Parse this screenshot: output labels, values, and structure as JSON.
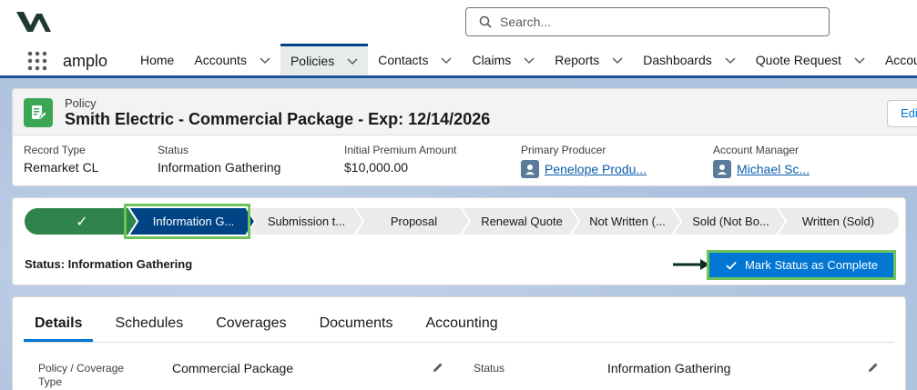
{
  "header": {
    "search_placeholder": "Search..."
  },
  "nav": {
    "app_name": "amplo",
    "items": [
      {
        "label": "Home",
        "chevron": false,
        "active": false
      },
      {
        "label": "Accounts",
        "chevron": true,
        "active": false
      },
      {
        "label": "Policies",
        "chevron": true,
        "active": true
      },
      {
        "label": "Contacts",
        "chevron": true,
        "active": false
      },
      {
        "label": "Claims",
        "chevron": true,
        "active": false
      },
      {
        "label": "Reports",
        "chevron": true,
        "active": false
      },
      {
        "label": "Dashboards",
        "chevron": true,
        "active": false
      },
      {
        "label": "Quote Request",
        "chevron": true,
        "active": false
      },
      {
        "label": "Accou",
        "chevron": false,
        "active": false
      }
    ]
  },
  "record": {
    "object_label": "Policy",
    "title": "Smith Electric - Commercial Package - Exp: 12/14/2026",
    "edit_label": "Edi",
    "highlights": [
      {
        "label": "Record Type",
        "value": "Remarket CL",
        "link": false
      },
      {
        "label": "Status",
        "value": "Information Gathering",
        "link": false
      },
      {
        "label": "Initial Premium Amount",
        "value": "$10,000.00",
        "link": false
      },
      {
        "label": "Primary Producer",
        "value": "Penelope Produ...",
        "link": true
      },
      {
        "label": "Account Manager",
        "value": "Michael Sc...",
        "link": true
      }
    ]
  },
  "path": {
    "stages": [
      {
        "label": "✓",
        "state": "complete"
      },
      {
        "label": "Information G...",
        "state": "current"
      },
      {
        "label": "Submission t...",
        "state": "incomplete"
      },
      {
        "label": "Proposal",
        "state": "incomplete"
      },
      {
        "label": "Renewal Quote",
        "state": "incomplete"
      },
      {
        "label": "Not Written (...",
        "state": "incomplete"
      },
      {
        "label": "Sold (Not Bo...",
        "state": "incomplete"
      },
      {
        "label": "Written (Sold)",
        "state": "incomplete"
      }
    ],
    "status_text": "Status: Information Gathering",
    "mark_button": "Mark Status as Complete"
  },
  "details": {
    "tabs": [
      "Details",
      "Schedules",
      "Coverages",
      "Documents",
      "Accounting"
    ],
    "active_tab": "Details",
    "fields": [
      {
        "label": "Policy / Coverage Type",
        "value": "Commercial Package"
      },
      {
        "label": "Status",
        "value": "Information Gathering"
      }
    ]
  },
  "colors": {
    "brand_blue": "#0176d3",
    "path_complete": "#2e844a",
    "path_current": "#014486",
    "highlight_green": "#6cc45b"
  }
}
